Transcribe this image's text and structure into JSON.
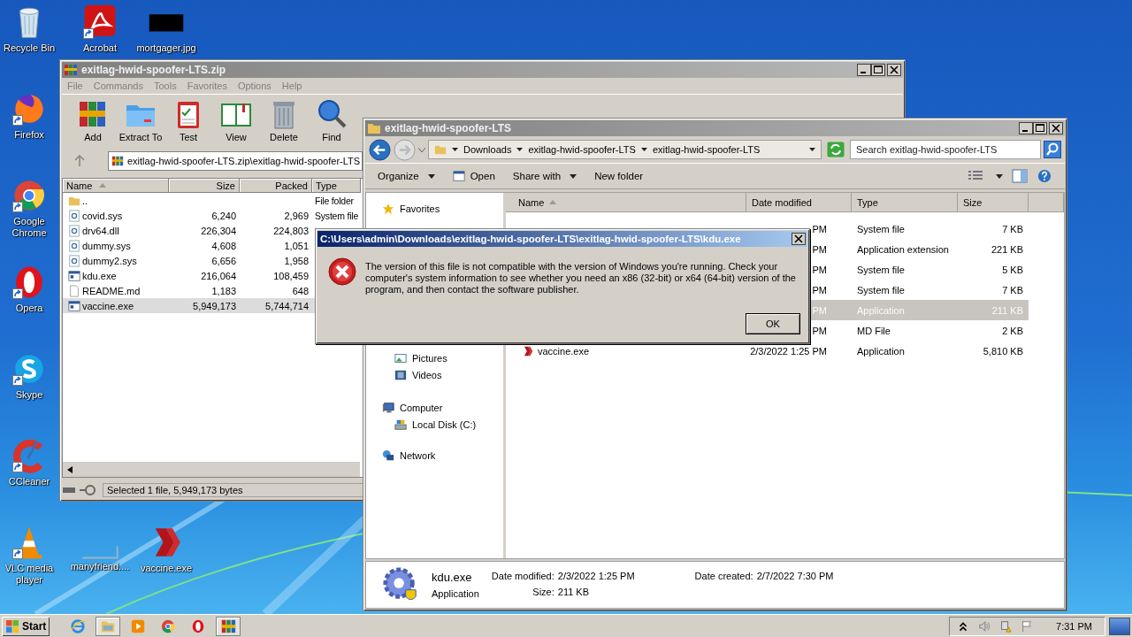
{
  "desktop_icons": [
    {
      "label": "Recycle Bin",
      "kind": "recycle-bin",
      "shortcut": false
    },
    {
      "label": "Acrobat",
      "kind": "pdf",
      "shortcut": true
    },
    {
      "label": "mortgager.jpg",
      "kind": "image",
      "shortcut": false
    },
    {
      "label": "Firefox",
      "kind": "firefox",
      "shortcut": true
    },
    {
      "label": "Google Chrome",
      "kind": "chrome",
      "shortcut": true
    },
    {
      "label": "Opera",
      "kind": "opera",
      "shortcut": true
    },
    {
      "label": "Skype",
      "kind": "skype",
      "shortcut": true
    },
    {
      "label": "CCleaner",
      "kind": "ccleaner",
      "shortcut": true
    },
    {
      "label": "VLC media player",
      "kind": "vlc",
      "shortcut": true
    },
    {
      "label": "manyfriend....",
      "kind": "blank",
      "shortcut": false
    },
    {
      "label": "vaccine.exe",
      "kind": "vaccine",
      "shortcut": false
    }
  ],
  "winrar": {
    "title": "exitlag-hwid-spoofer-LTS.zip",
    "menu": [
      "File",
      "Commands",
      "Tools",
      "Favorites",
      "Options",
      "Help"
    ],
    "toolbar": [
      {
        "label": "Add",
        "kind": "add"
      },
      {
        "label": "Extract To",
        "kind": "extract"
      },
      {
        "label": "Test",
        "kind": "test"
      },
      {
        "label": "View",
        "kind": "view"
      },
      {
        "label": "Delete",
        "kind": "delete"
      },
      {
        "label": "Find",
        "kind": "find"
      }
    ],
    "path": "exitlag-hwid-spoofer-LTS.zip\\exitlag-hwid-spoofer-LTS",
    "columns": [
      "Name",
      "Size",
      "Packed",
      "Type"
    ],
    "rows": [
      {
        "name": "..",
        "kind": "folder",
        "type": "File folder",
        "selected": false
      },
      {
        "name": "covid.sys",
        "kind": "system",
        "size": "6,240",
        "packed": "2,969",
        "type": "System file",
        "selected": false
      },
      {
        "name": "drv64.dll",
        "kind": "system",
        "size": "226,304",
        "packed": "224,803",
        "selected": false
      },
      {
        "name": "dummy.sys",
        "kind": "system",
        "size": "4,608",
        "packed": "1,051",
        "selected": false
      },
      {
        "name": "dummy2.sys",
        "kind": "system",
        "size": "6,656",
        "packed": "1,958",
        "selected": false
      },
      {
        "name": "kdu.exe",
        "kind": "exe",
        "size": "216,064",
        "packed": "108,459",
        "selected": false
      },
      {
        "name": "README.md",
        "kind": "text",
        "size": "1,183",
        "packed": "648",
        "selected": false
      },
      {
        "name": "vaccine.exe",
        "kind": "exe",
        "size": "5,949,173",
        "packed": "5,744,714",
        "selected": true
      }
    ],
    "status": "Selected 1 file, 5,949,173 bytes"
  },
  "explorer": {
    "title": "exitlag-hwid-spoofer-LTS",
    "breadcrumb": [
      "Downloads",
      "exitlag-hwid-spoofer-LTS",
      "exitlag-hwid-spoofer-LTS"
    ],
    "search": {
      "placeholder": "Search exitlag-hwid-spoofer-LTS"
    },
    "commands": [
      {
        "label": "Organize",
        "kind": "menu"
      },
      {
        "label": "Open",
        "kind": "open"
      },
      {
        "label": "Share with",
        "kind": "menu"
      },
      {
        "label": "New folder",
        "kind": "plain"
      }
    ],
    "nav": [
      {
        "label": "Favorites",
        "kind": "favorites"
      },
      {
        "kind": "libraries",
        "children": [
          {
            "label": "Pictures",
            "kind": "pictures"
          },
          {
            "label": "Videos",
            "kind": "videos"
          }
        ]
      },
      {
        "label": "Computer",
        "kind": "computer",
        "children": [
          {
            "label": "Local Disk (C:)",
            "kind": "disk"
          }
        ]
      },
      {
        "label": "Network",
        "kind": "network"
      }
    ],
    "columns": [
      "Name",
      "Date modified",
      "Type",
      "Size"
    ],
    "rows": [
      {
        "date": "PM",
        "type": "System file",
        "size": "7 KB",
        "selected": false
      },
      {
        "date": "PM",
        "type": "Application extension",
        "size": "221 KB",
        "selected": false
      },
      {
        "date": "PM",
        "type": "System file",
        "size": "5 KB",
        "selected": false
      },
      {
        "date": "PM",
        "type": "System file",
        "size": "7 KB",
        "selected": false
      },
      {
        "date": "PM",
        "type": "Application",
        "size": "211 KB",
        "selected": true
      },
      {
        "date": "PM",
        "type": "MD File",
        "size": "2 KB",
        "selected": false
      },
      {
        "name": "vaccine.exe",
        "kind": "vaccine",
        "date": "2/3/2022 1:25 PM",
        "type": "Application",
        "size": "5,810 KB",
        "selected": false
      }
    ],
    "details": {
      "name": "kdu.exe",
      "type": "Application",
      "fields": [
        {
          "label": "Date modified:",
          "value": "2/3/2022 1:25 PM"
        },
        {
          "label": "Size:",
          "value": "211 KB"
        },
        {
          "label": "Date created:",
          "value": "2/7/2022 7:30 PM"
        }
      ]
    }
  },
  "dialog": {
    "title": "C:\\Users\\admin\\Downloads\\exitlag-hwid-spoofer-LTS\\exitlag-hwid-spoofer-LTS\\kdu.exe",
    "message": "The version of this file is not compatible with the version of Windows you're running. Check your computer's system information to see whether you need an x86 (32-bit) or x64 (64-bit) version of the program, and then contact the software publisher.",
    "button": "OK"
  },
  "taskbar": {
    "start": "Start",
    "apps": [
      {
        "kind": "ie",
        "selected": false
      },
      {
        "kind": "explorer",
        "selected": true
      },
      {
        "kind": "media",
        "selected": false
      },
      {
        "kind": "chrome",
        "selected": false
      },
      {
        "kind": "opera",
        "selected": false
      },
      {
        "kind": "winrar",
        "selected": true
      }
    ],
    "clock": "7:31 PM"
  }
}
